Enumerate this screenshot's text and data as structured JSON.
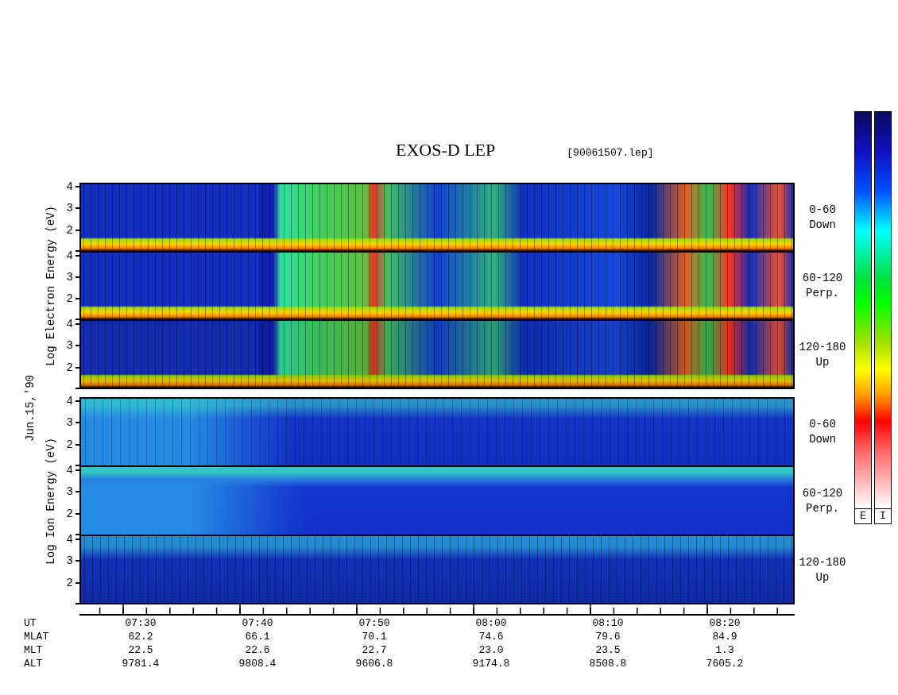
{
  "title": "EXOS-D LEP",
  "file_label": "[90061507.lep]",
  "date": "Jun.15,'90",
  "groups": [
    {
      "kind": "electron",
      "axis_label": "Log Electron Energy (eV)",
      "panels": [
        {
          "range": "0-60",
          "direction": "Down",
          "yticks": [
            "4",
            "3",
            "2"
          ]
        },
        {
          "range": "60-120",
          "direction": "Perp.",
          "yticks": [
            "4",
            "3",
            "2"
          ]
        },
        {
          "range": "120-180",
          "direction": "Up",
          "yticks": [
            "4",
            "3",
            "2"
          ]
        }
      ]
    },
    {
      "kind": "ion",
      "axis_label": "Log Ion Energy (eV)",
      "panels": [
        {
          "range": "0-60",
          "direction": "Down",
          "yticks": [
            "4",
            "3",
            "2"
          ]
        },
        {
          "range": "60-120",
          "direction": "Perp.",
          "yticks": [
            "4",
            "3",
            "2"
          ]
        },
        {
          "range": "120-180",
          "direction": "Up",
          "yticks": [
            "4",
            "3",
            "2"
          ]
        }
      ]
    }
  ],
  "time_axis": [
    {
      "label": "UT",
      "values": [
        "07:30",
        "07:40",
        "07:50",
        "08:00",
        "08:10",
        "08:20"
      ]
    },
    {
      "label": "MLAT",
      "values": [
        "62.2",
        "66.1",
        "70.1",
        "74.6",
        "79.6",
        "84.9"
      ]
    },
    {
      "label": "MLT",
      "values": [
        "22.5",
        "22.6",
        "22.7",
        "23.0",
        "23.5",
        "1.3"
      ]
    },
    {
      "label": "ALT",
      "values": [
        "9781.4",
        "9808.4",
        "9606.8",
        "9174.8",
        "8508.8",
        "7605.2"
      ]
    }
  ],
  "colorbars": [
    {
      "label": "E"
    },
    {
      "label": "I"
    }
  ]
}
